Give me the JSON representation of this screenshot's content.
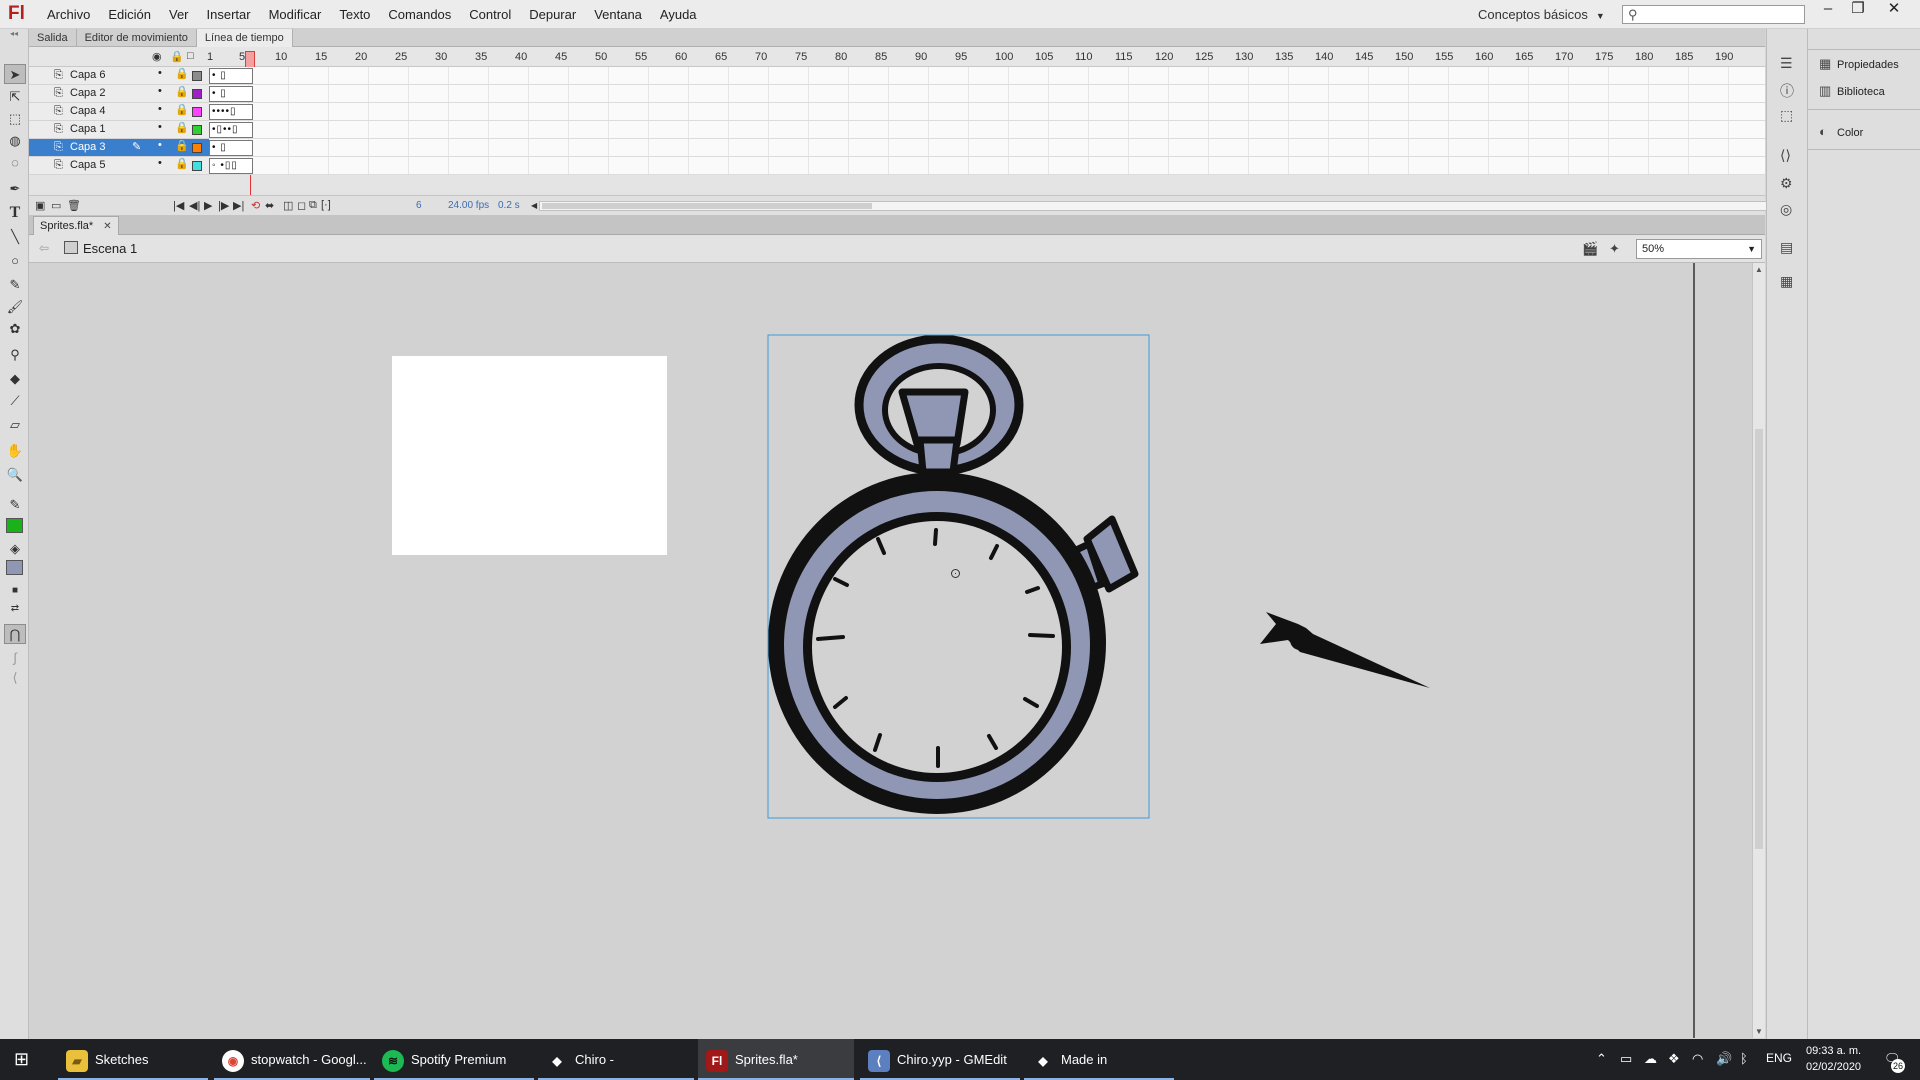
{
  "app": {
    "logo": "Fl",
    "menus": [
      "Archivo",
      "Edición",
      "Ver",
      "Insertar",
      "Modificar",
      "Texto",
      "Comandos",
      "Control",
      "Depurar",
      "Ventana",
      "Ayuda"
    ],
    "workspace": "Conceptos básicos",
    "search_placeholder": ""
  },
  "panel_tabs": [
    "Salida",
    "Editor de movimiento",
    "Línea de tiempo"
  ],
  "timeline": {
    "ticks": [
      "1",
      "5",
      "10",
      "15",
      "20",
      "25",
      "30",
      "35",
      "40",
      "45",
      "50",
      "55",
      "60",
      "65",
      "70",
      "75",
      "80",
      "85",
      "90",
      "95",
      "100",
      "105",
      "110",
      "115",
      "120",
      "125",
      "130",
      "135",
      "140",
      "145",
      "150",
      "155",
      "160",
      "165",
      "170",
      "175",
      "180",
      "185",
      "190"
    ],
    "layers": [
      {
        "name": "Capa 6",
        "color": "#8c8c8c",
        "frames": "•   ▯"
      },
      {
        "name": "Capa 2",
        "color": "#a020c8",
        "frames": "•   ▯"
      },
      {
        "name": "Capa 4",
        "color": "#ff40ff",
        "frames": "••••▯"
      },
      {
        "name": "Capa 1",
        "color": "#30d030",
        "frames": "•▯••▯"
      },
      {
        "name": "Capa 3",
        "color": "#ff8000",
        "frames": "•   ▯",
        "selected": true
      },
      {
        "name": "Capa 5",
        "color": "#40e0e0",
        "frames": "◦ •▯▯"
      }
    ],
    "current_frame": "6",
    "fps": "24.00 fps",
    "time": "0.2 s"
  },
  "document": {
    "tab": "Sprites.fla*",
    "scene": "Escena 1",
    "zoom": "50%"
  },
  "tools": {
    "stroke_color": "#19b319",
    "fill_color": "#8f97b4"
  },
  "right_panel": {
    "items": [
      "Propiedades",
      "Biblioteca",
      "Color"
    ]
  },
  "taskbar": {
    "tasks": [
      {
        "label": "Sketches",
        "icon": "folder-icon"
      },
      {
        "label": "stopwatch - Googl...",
        "icon": "chrome-icon"
      },
      {
        "label": "Spotify Premium",
        "icon": "spotify-icon"
      },
      {
        "label": "Chiro - GameMake...",
        "icon": "gamemaker-icon"
      },
      {
        "label": "Sprites.fla*",
        "icon": "flash-icon",
        "active": true
      },
      {
        "label": "Chiro.yyp - GMEdit",
        "icon": "gmedit-icon"
      },
      {
        "label": "Made in GameMak...",
        "icon": "gamemaker-icon"
      }
    ],
    "lang": "ENG",
    "time": "09:33 a. m.",
    "date": "02/02/2020",
    "notifications": "26"
  }
}
